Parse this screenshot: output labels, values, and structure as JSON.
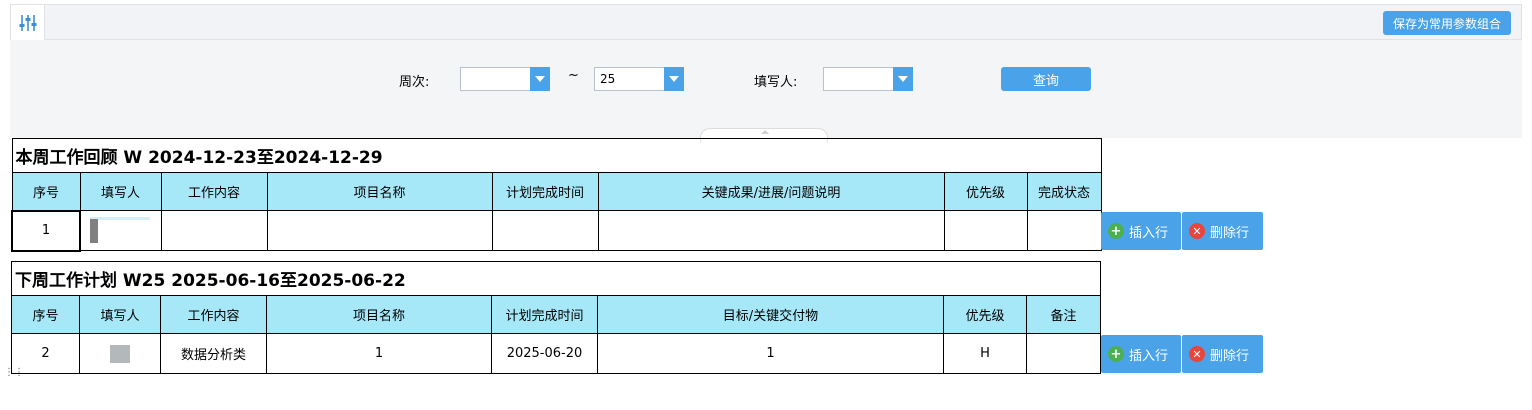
{
  "toolbar": {
    "filter_icon": "sliders-icon",
    "save_label": "保存为常用参数组合"
  },
  "filter": {
    "week_label": "周次:",
    "week_from_value": "",
    "tilde": "~",
    "week_to_value": "25",
    "writer_label": "填写人:",
    "writer_value": "",
    "query_label": "查询"
  },
  "review_table": {
    "title": "本周工作回顾 W 2024-12-23至2024-12-29",
    "headers": [
      "序号",
      "填写人",
      "工作内容",
      "项目名称",
      "计划完成时间",
      "关键成果/进展/问题说明",
      "优先级",
      "完成状态"
    ],
    "rows": [
      {
        "no": "1",
        "writer": "",
        "content": "",
        "project": "",
        "plan_date": "",
        "result": "",
        "priority": "",
        "status": ""
      }
    ]
  },
  "plan_table": {
    "title": "下周工作计划 W25 2025-06-16至2025-06-22",
    "headers": [
      "序号",
      "填写人",
      "工作内容",
      "项目名称",
      "计划完成时间",
      "目标/关键交付物",
      "优先级",
      "备注"
    ],
    "rows": [
      {
        "no": "2",
        "writer": "",
        "content": "数据分析类",
        "project": "1",
        "plan_date": "2025-06-20",
        "target": "1",
        "priority": "H",
        "note": ""
      }
    ]
  },
  "row_actions": {
    "insert_label": "插入行",
    "delete_label": "删除行"
  },
  "colors": {
    "accent": "#4aa3e8",
    "header_bg": "#a7e8f8",
    "insert_icon": "#4cb050",
    "delete_icon": "#e8453c"
  }
}
